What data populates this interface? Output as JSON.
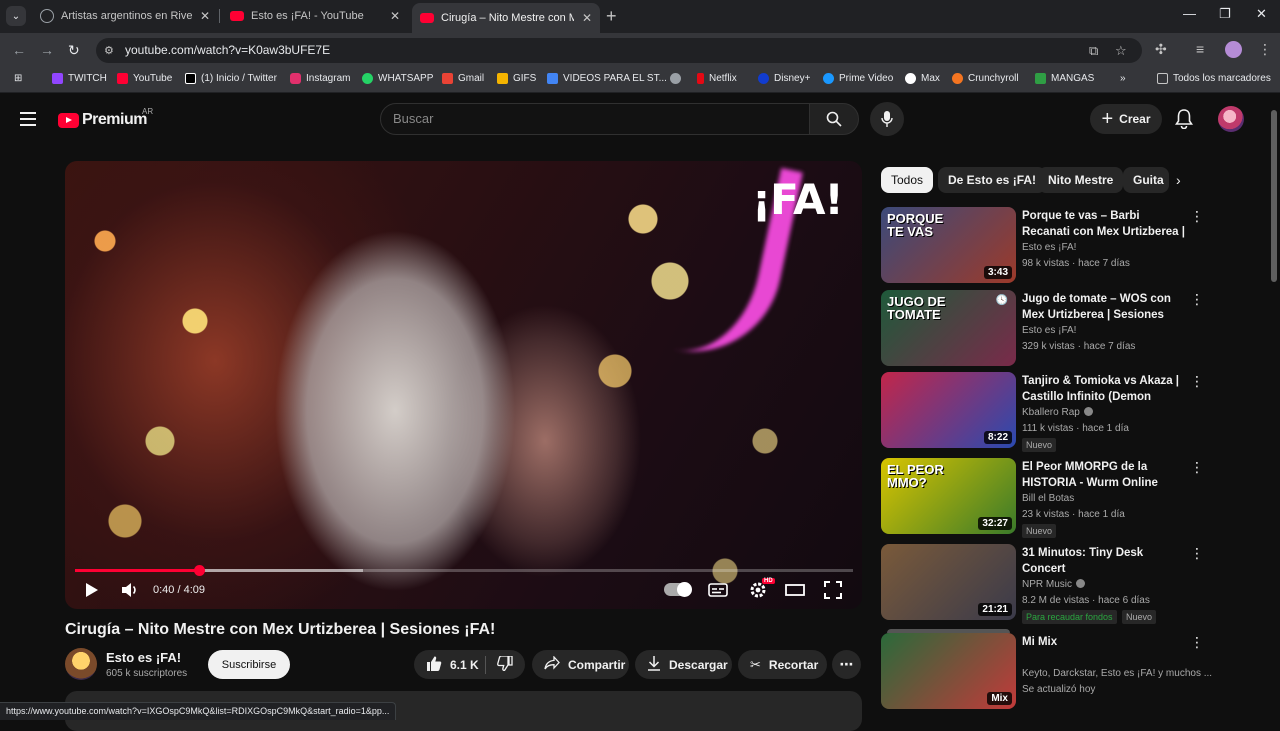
{
  "browser": {
    "tabs": [
      {
        "title": "Artistas argentinos en River",
        "favicon": "globe-icon",
        "active": false
      },
      {
        "title": "Esto es ¡FA! - YouTube",
        "favicon": "youtube-icon",
        "active": false
      },
      {
        "title": "Cirugía – Nito Mestre con Mex U",
        "favicon": "youtube-icon",
        "active": true
      }
    ],
    "url": "youtube.com/watch?v=K0aw3bUFE7E",
    "bookmarks": [
      {
        "label": "TWITCH",
        "color": "#9146ff"
      },
      {
        "label": "YouTube",
        "color": "#ff0033"
      },
      {
        "label": "(1) Inicio / Twitter",
        "color": "#ffffff"
      },
      {
        "label": "Instagram",
        "color": "#e1306c"
      },
      {
        "label": "WHATSAPP",
        "color": "#25d366"
      },
      {
        "label": "Gmail",
        "color": "#ea4335"
      },
      {
        "label": "GIFS",
        "color": "#f5b400"
      },
      {
        "label": "VIDEOS PARA EL ST...",
        "color": "#4285f4"
      },
      {
        "label": "",
        "color": "#9aa0a6"
      },
      {
        "label": "Netflix",
        "color": "#e50914"
      },
      {
        "label": "Disney+",
        "color": "#113ccf"
      },
      {
        "label": "Prime Video",
        "color": "#1a98ff"
      },
      {
        "label": "Max",
        "color": "#ffffff"
      },
      {
        "label": "Crunchyroll",
        "color": "#f47521"
      },
      {
        "label": "MANGAS",
        "color": "#2f9e44"
      }
    ],
    "all_bookmarks": "Todos los marcadores",
    "status_url": "https://www.youtube.com/watch?v=IXGOspC9MkQ&list=RDIXGOspC9MkQ&start_radio=1&pp..."
  },
  "youtube": {
    "logo_text": "Premium",
    "region": "AR",
    "search_placeholder": "Buscar",
    "create_label": "Crear",
    "player": {
      "watermark": "¡FA!",
      "time": "0:40 / 4:09",
      "progress": 0.16,
      "buffered": 0.37,
      "hd_badge": "HD"
    },
    "video": {
      "title": "Cirugía – Nito Mestre con Mex Urtizberea | Sesiones ¡FA!",
      "channel": "Esto es ¡FA!",
      "subscribers": "605 k suscriptores",
      "subscribe_label": "Suscribirse",
      "likes": "6.1 K",
      "share_label": "Compartir",
      "download_label": "Descargar",
      "clip_label": "Recortar"
    },
    "chips": [
      {
        "label": "Todos",
        "active": true
      },
      {
        "label": "De Esto es ¡FA!",
        "active": false
      },
      {
        "label": "Nito Mestre",
        "active": false
      },
      {
        "label": "Guita",
        "active": false
      }
    ],
    "recommendations": [
      {
        "title": "Porque te vas – Barbi Recanati con Mex Urtizberea | Sesiones...",
        "channel": "Esto es ¡FA!",
        "meta": "98 k vistas · hace 7 días",
        "duration": "3:43",
        "thumb_text": "PORQUE TE VAS",
        "thumb_colors": [
          "#3b4a7a",
          "#9c3a2a"
        ],
        "badges": []
      },
      {
        "title": "Jugo de tomate – WOS con Mex Urtizberea | Sesiones ¡FA!",
        "channel": "Esto es ¡FA!",
        "meta": "329 k vistas · hace 7 días",
        "duration": "",
        "thumb_text": "JUGO DE TOMATE",
        "thumb_colors": [
          "#1e5a3a",
          "#7a2a4a"
        ],
        "badges": []
      },
      {
        "title": "Tanjiro & Tomioka vs Akaza | Castillo Infinito (Demon Slaye...",
        "channel": "Kballero Rap",
        "meta": "111 k vistas · hace 1 día",
        "duration": "8:22",
        "thumb_text": "",
        "thumb_colors": [
          "#c2264a",
          "#2a4ab0"
        ],
        "badges": [
          "Nuevo"
        ],
        "verified": true
      },
      {
        "title": "El Peor MMORPG de la HISTORIA - Wurm Online",
        "channel": "Bill el Botas",
        "meta": "23 k vistas · hace 1 día",
        "duration": "32:27",
        "thumb_text": "EL PEOR MMO?",
        "thumb_colors": [
          "#d8c400",
          "#3a7a2a"
        ],
        "badges": [
          "Nuevo"
        ]
      },
      {
        "title": "31 Minutos: Tiny Desk Concert",
        "channel": "NPR Music",
        "meta": "8.2 M de vistas · hace 6 días",
        "duration": "21:21",
        "thumb_text": "",
        "thumb_colors": [
          "#7a5a3a",
          "#3a3a4a"
        ],
        "badges": [
          "Para recaudar fondos",
          "Nuevo"
        ],
        "verified": true
      },
      {
        "title": "Mi Mix",
        "channel": "Keyto, Darckstar, Esto es ¡FA! y muchos ...",
        "meta": "Se actualizó hoy",
        "duration": "Mix",
        "thumb_text": "",
        "thumb_colors": [
          "#2a6a3a",
          "#c23a3a"
        ],
        "badges": []
      }
    ]
  }
}
